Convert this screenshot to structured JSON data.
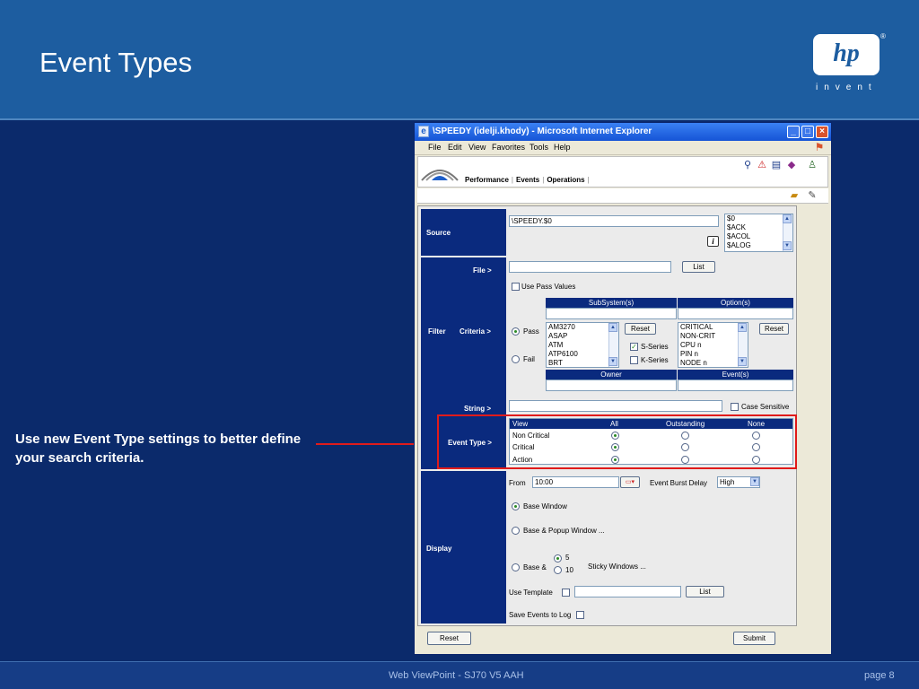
{
  "slide": {
    "title": "Event Types",
    "logo_text": "hp",
    "logo_reg": "®",
    "logo_tagline": "invent",
    "callout": "Use new Event Type settings to better define your search criteria.",
    "footer_center": "Web ViewPoint - SJ70 V5 AAH",
    "footer_page": "page 8"
  },
  "window": {
    "title": "\\SPEEDY (idelji.khody) - Microsoft Internet Explorer",
    "menu": [
      "File",
      "Edit",
      "View",
      "Favorites",
      "Tools",
      "Help"
    ],
    "minimize": "_",
    "maximize": "□",
    "close": "×"
  },
  "app": {
    "tabs": [
      "Performance",
      "Events",
      "Operations"
    ],
    "tab_sep": "|"
  },
  "form": {
    "source": {
      "label": "Source",
      "value": "\\SPEEDY.$0",
      "list": [
        "$0",
        "$ACK",
        "$ACOL",
        "$ALOG"
      ],
      "info": "i"
    },
    "filter": {
      "label": "Filter",
      "file_label": "File  >",
      "list_button": "List",
      "use_pass_values": "Use Pass Values",
      "criteria_label": "Criteria  >",
      "pass": "Pass",
      "fail": "Fail",
      "subsystems_header": "SubSystem(s)",
      "options_header": "Option(s)",
      "subsystems": [
        "AM3270",
        "ASAP",
        "ATM",
        "ATP6100",
        "BRT"
      ],
      "options": [
        "CRITICAL",
        "NON-CRIT",
        "CPU n",
        "PIN n",
        "NODE n"
      ],
      "reset_button": "Reset",
      "s_series": "S-Series",
      "k_series": "K-Series",
      "owner_header": "Owner",
      "events_header": "Event(s)",
      "string_label": "String  >",
      "case_sensitive": "Case Sensitive"
    },
    "event_type": {
      "label": "Event Type  >",
      "columns": [
        "View",
        "All",
        "Outstanding",
        "None"
      ],
      "rows": [
        {
          "label": "Non Critical",
          "selected": "All"
        },
        {
          "label": "Critical",
          "selected": "All"
        },
        {
          "label": "Action",
          "selected": "All"
        }
      ]
    },
    "display": {
      "label": "Display",
      "from_label": "From",
      "from_value": "10:00",
      "burst_label": "Event Burst Delay",
      "burst_value": "High",
      "base_window": "Base Window",
      "base_popup": "Base & Popup Window ...",
      "base_and": "Base &",
      "five": "5",
      "ten": "10",
      "sticky": "Sticky Windows ...",
      "use_template": "Use Template",
      "list_button": "List",
      "save_events": "Save Events to Log"
    },
    "reset_button": "Reset",
    "submit_button": "Submit"
  },
  "colors": {
    "slide_bg": "#0b2a6b",
    "header_bg": "#1d5da0",
    "label_column": "#0a2a7e",
    "highlight": "#e01b1b"
  },
  "icons": [
    "hp-logo",
    "ie-icon",
    "windows-flag-icon",
    "search-icon",
    "alerts-icon",
    "print-icon",
    "book-icon",
    "user-icon",
    "folder-icon",
    "help-book-icon",
    "info-icon"
  ]
}
